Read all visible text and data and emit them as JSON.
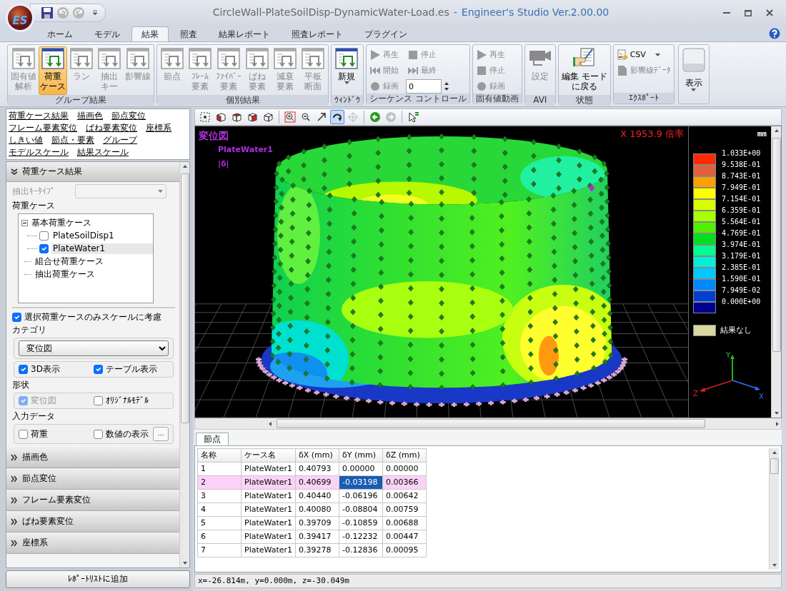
{
  "window": {
    "logo_text": "ES",
    "file": "CircleWall-PlateSoilDisp-DynamicWater-Load.es",
    "separator": "-",
    "app": "Engineer's Studio Ver.2.00.00"
  },
  "tabs": [
    {
      "label": "ホーム",
      "selected": false
    },
    {
      "label": "モデル",
      "selected": false
    },
    {
      "label": "結果",
      "selected": true
    },
    {
      "label": "照査",
      "selected": false
    },
    {
      "label": "結果レポート",
      "selected": false
    },
    {
      "label": "照査レポート",
      "selected": false
    },
    {
      "label": "プラグイン",
      "selected": false
    }
  ],
  "ribbon": [
    {
      "label": "グループ結果",
      "items": [
        {
          "kind": "window",
          "lines": [
            "固有値",
            "解析"
          ],
          "disabled": true,
          "selected": false
        },
        {
          "kind": "window",
          "lines": [
            "荷重",
            "ケース"
          ],
          "disabled": false,
          "selected": true
        },
        {
          "kind": "window",
          "lines": [
            "ラン"
          ],
          "disabled": true,
          "selected": false
        },
        {
          "kind": "window",
          "lines": [
            "抽出",
            "キー"
          ],
          "disabled": true,
          "selected": false
        },
        {
          "kind": "window",
          "lines": [
            "影響線"
          ],
          "disabled": true,
          "selected": false
        }
      ]
    },
    {
      "label": "個別結果",
      "items": [
        {
          "kind": "window",
          "lines": [
            "節点"
          ],
          "disabled": true,
          "selected": false
        },
        {
          "kind": "window",
          "lines": [
            "ﾌﾚｰﾑ",
            "要素"
          ],
          "disabled": true,
          "selected": false
        },
        {
          "kind": "window",
          "lines": [
            "ﾌｧｲﾊﾞｰ",
            "要素"
          ],
          "disabled": true,
          "selected": false
        },
        {
          "kind": "window",
          "lines": [
            "ばね",
            "要素"
          ],
          "disabled": true,
          "selected": false
        },
        {
          "kind": "window",
          "lines": [
            "減衰",
            "要素"
          ],
          "disabled": true,
          "selected": false
        },
        {
          "kind": "window",
          "lines": [
            "平板",
            "断面"
          ],
          "disabled": true,
          "selected": false
        }
      ]
    },
    {
      "label": "ｳｨﾝﾄﾞｳ",
      "items": [
        {
          "kind": "window",
          "lines": [
            "新規"
          ],
          "disabled": false,
          "selected": false,
          "dropdown": true
        }
      ]
    },
    {
      "label": "シーケンス コントロール",
      "items": [
        {
          "kind": "play",
          "label": "再生",
          "disabled": true
        },
        {
          "kind": "stop",
          "label": "停止",
          "disabled": true
        },
        {
          "kind": "first",
          "label": "開始",
          "disabled": true
        },
        {
          "kind": "last",
          "label": "最終",
          "disabled": true
        },
        {
          "kind": "record",
          "label": "録画",
          "disabled": true
        },
        {
          "kind": "spin",
          "value": "0",
          "disabled": false
        }
      ]
    },
    {
      "label": "固有値動画",
      "items": [
        {
          "kind": "play",
          "label": "再生",
          "disabled": true
        },
        {
          "kind": "stop",
          "label": "停止",
          "disabled": true
        },
        {
          "kind": "record",
          "label": "録画",
          "disabled": true
        }
      ]
    },
    {
      "label": "AVI",
      "items": [
        {
          "kind": "camera",
          "lines": [
            "設定"
          ],
          "disabled": true,
          "selected": false
        }
      ]
    },
    {
      "label": "状態",
      "items": [
        {
          "kind": "edit",
          "lines": [
            "編集 モード",
            "に戻る"
          ],
          "disabled": false,
          "selected": false
        }
      ]
    },
    {
      "label": "ｴｸｽﾎﾟｰﾄ",
      "items": [
        {
          "kind": "csv",
          "label": "CSV",
          "disabled": false,
          "dropdown": true
        },
        {
          "kind": "doc",
          "label": "影響線ﾃﾞｰﾀ",
          "disabled": true
        }
      ]
    }
  ],
  "view_button": {
    "label": "表示",
    "dropdown": true
  },
  "side_panel": {
    "links": [
      [
        "荷重ケース結果",
        "描画色",
        "節点変位"
      ],
      [
        "フレーム要素変位",
        "ばね要素変位",
        "座標系"
      ],
      [
        "しきい値",
        "節点・要素",
        "グループ"
      ],
      [
        "モデルスケール",
        "結果スケール"
      ]
    ],
    "open_section": {
      "title": "荷重ケース結果",
      "expanded": true
    },
    "key_type": {
      "label": "抽出ｷｰﾀｲﾌﾟ",
      "disabled": true
    },
    "case_label": "荷重ケース",
    "tree": [
      {
        "label": "基本荷重ケース",
        "expanded": true,
        "selected": false,
        "children": [
          {
            "label": "PlateSoilDisp1",
            "checked": false,
            "selected": false
          },
          {
            "label": "PlateWater1",
            "checked": true,
            "selected": true
          }
        ]
      },
      {
        "label": "組合せ荷重ケース",
        "selected": false
      },
      {
        "label": "抽出荷重ケース",
        "selected": false
      }
    ],
    "scale_option": {
      "label": "選択荷重ケースのみスケールに考慮",
      "checked": true
    },
    "category": {
      "legend": "カテゴリ",
      "value": "変位図"
    },
    "display": [
      {
        "label": "3D表示",
        "checked": true,
        "disabled": false
      },
      {
        "label": "テーブル表示",
        "checked": true,
        "disabled": false
      }
    ],
    "shape": {
      "legend": "形状",
      "options": [
        {
          "label": "変位図",
          "checked": true,
          "disabled": true
        },
        {
          "label": "ｵﾘｼﾞﾅﾙﾓﾃﾞﾙ",
          "checked": false,
          "disabled": false
        }
      ]
    },
    "input_data": {
      "legend": "入力データ",
      "options": [
        {
          "label": "荷重",
          "checked": false,
          "disabled": false
        },
        {
          "label": "数値の表示",
          "checked": false,
          "disabled": false
        }
      ],
      "more_button": "..."
    },
    "sections": [
      {
        "title": "描画色",
        "expanded": false
      },
      {
        "title": "節点変位",
        "expanded": false
      },
      {
        "title": "フレーム要素変位",
        "expanded": false
      },
      {
        "title": "ばね要素変位",
        "expanded": false
      },
      {
        "title": "座標系",
        "expanded": false
      }
    ],
    "report_button": "ﾚﾎﾟｰﾄﾘｽﾄに追加"
  },
  "view_toolbar": [
    [
      {
        "kind": "fit",
        "pressed": false,
        "disabled": false
      },
      {
        "kind": "front",
        "pressed": false,
        "disabled": false
      },
      {
        "kind": "top",
        "pressed": false,
        "disabled": false
      },
      {
        "kind": "side",
        "pressed": false,
        "disabled": false
      },
      {
        "kind": "iso",
        "pressed": false,
        "disabled": false
      }
    ],
    [
      {
        "kind": "zoomwindow",
        "pressed": false,
        "disabled": false
      },
      {
        "kind": "zoomout",
        "pressed": false,
        "disabled": false
      },
      {
        "kind": "arrow",
        "pressed": false,
        "disabled": false
      },
      {
        "kind": "rotate",
        "pressed": true,
        "disabled": false
      },
      {
        "kind": "pan",
        "pressed": false,
        "disabled": true
      }
    ],
    [
      {
        "kind": "back",
        "pressed": false,
        "disabled": false
      },
      {
        "kind": "forward",
        "pressed": false,
        "disabled": true
      }
    ],
    [
      {
        "kind": "select",
        "pressed": false,
        "disabled": false
      }
    ]
  ],
  "viewport": {
    "title": "変位図",
    "case": "PlateWater1",
    "quantity": "|δ|",
    "scale": "X 1953.9 倍率"
  },
  "legend": {
    "unit": "mm",
    "labels": [
      "1.033E+00",
      "9.538E-01",
      "8.743E-01",
      "7.949E-01",
      "7.154E-01",
      "6.359E-01",
      "5.564E-01",
      "4.769E-01",
      "3.974E-01",
      "3.179E-01",
      "2.385E-01",
      "1.590E-01",
      "7.949E-02",
      "0.000E+00"
    ],
    "bands": [
      {
        "color": "#ff2800"
      },
      {
        "color": "#e0603c"
      },
      {
        "color": "#ffa000"
      },
      {
        "color": "#ffff00"
      },
      {
        "color": "#d8ff00"
      },
      {
        "color": "#a8ff00"
      },
      {
        "color": "#50f000"
      },
      {
        "color": "#00e020"
      },
      {
        "color": "#00ff90"
      },
      {
        "color": "#00f0d8"
      },
      {
        "color": "#00c8ff"
      },
      {
        "color": "#0088ff"
      },
      {
        "color": "#0040d0"
      },
      {
        "color": "#000090"
      }
    ],
    "no_result": {
      "label": "結果なし",
      "color": "#d8d8a0"
    },
    "axis_labels": {
      "y": "Y",
      "z": "Z",
      "x": "X"
    }
  },
  "table": {
    "tab": "節点",
    "columns": [
      "名称",
      "ケース名",
      "δX (mm)",
      "δY (mm)",
      "δZ (mm)"
    ],
    "rows": [
      {
        "selected": false,
        "cells": [
          "1",
          "PlateWater1",
          "0.40793",
          "0.00000",
          "0.00000"
        ]
      },
      {
        "selected": true,
        "cells": [
          "2",
          "PlateWater1",
          "0.40699",
          {
            "text": "-0.03198",
            "focused": true
          },
          "0.00366"
        ]
      },
      {
        "selected": false,
        "cells": [
          "3",
          "PlateWater1",
          "0.40440",
          "-0.06196",
          "0.00642"
        ]
      },
      {
        "selected": false,
        "cells": [
          "4",
          "PlateWater1",
          "0.40080",
          "-0.08804",
          "0.00759"
        ]
      },
      {
        "selected": false,
        "cells": [
          "5",
          "PlateWater1",
          "0.39709",
          "-0.10859",
          "0.00688"
        ]
      },
      {
        "selected": false,
        "cells": [
          "6",
          "PlateWater1",
          "0.39417",
          "-0.12232",
          "0.00447"
        ]
      },
      {
        "selected": false,
        "cells": [
          "7",
          "PlateWater1",
          "0.39278",
          "-0.12836",
          "0.00095"
        ]
      }
    ]
  },
  "status_bar": "x=-26.814m, y=0.000m, z=-30.049m"
}
